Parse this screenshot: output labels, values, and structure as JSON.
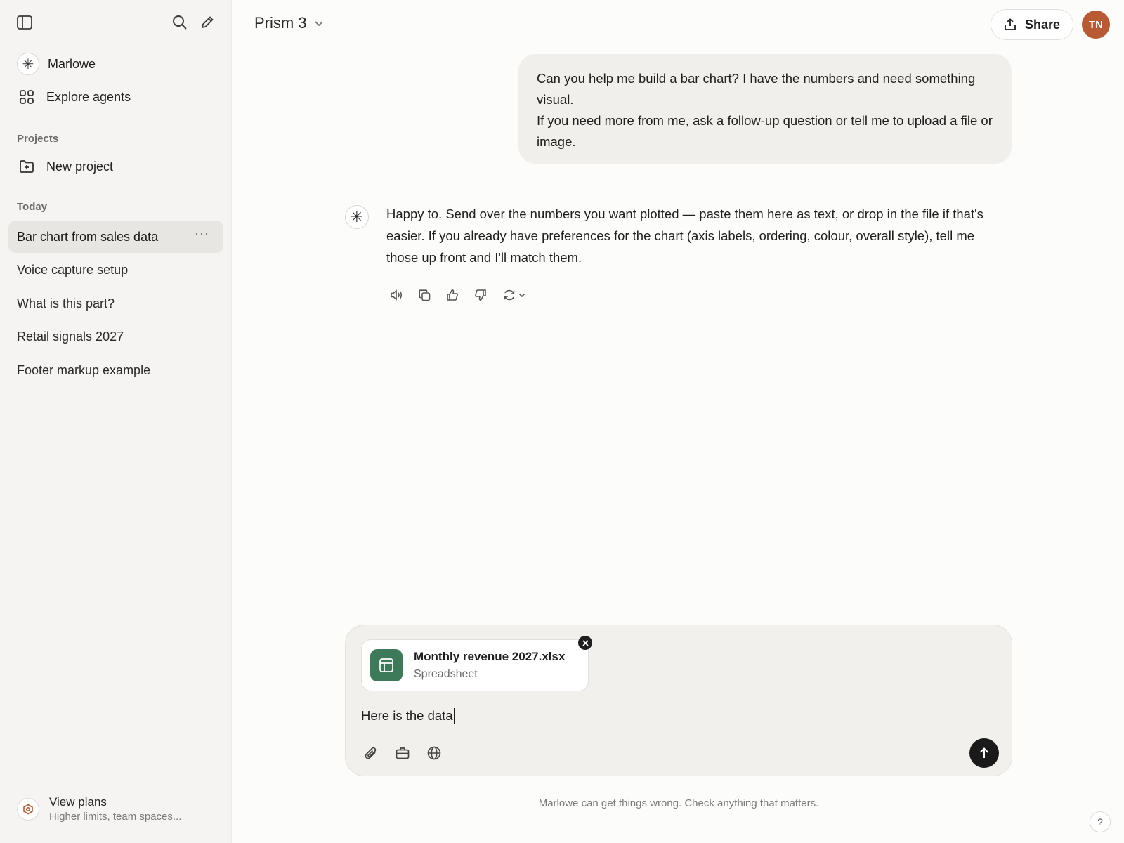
{
  "sidebar": {
    "toggle_icon": "sidebar-toggle-icon",
    "search_icon": "search-icon",
    "new_chat_icon": "pencil-icon",
    "brand": {
      "label": "Marlowe",
      "icon": "asterisk-icon"
    },
    "explore": {
      "label": "Explore agents",
      "icon": "grid-icon"
    },
    "projects_heading": "Projects",
    "new_project": {
      "label": "New project",
      "icon": "folder-plus-icon"
    },
    "today_heading": "Today",
    "chats": [
      {
        "label": "Bar chart from sales data",
        "active": true,
        "more": "···"
      },
      {
        "label": "Voice capture setup"
      },
      {
        "label": "What is this part?"
      },
      {
        "label": "Retail signals 2027"
      },
      {
        "label": "Footer markup example"
      }
    ],
    "plans": {
      "title": "View plans",
      "subtitle": "Higher limits, team spaces..."
    }
  },
  "header": {
    "model": "Prism 3",
    "share_label": "Share",
    "avatar_initials": "TN",
    "avatar_color": "#b85a33"
  },
  "conversation": {
    "user_message": {
      "line1": "Can you help me build a bar chart? I have the numbers and need something visual.",
      "line2": "If you need more from me, ask a follow-up question or tell me to upload a file or image."
    },
    "assistant_message": "Happy to. Send over the numbers you want plotted — paste them here as text, or drop in the file if that's easier. If you already have preferences for the chart (axis labels, ordering, colour, overall style), tell me those up front and I'll match them.",
    "actions": [
      "speaker-icon",
      "copy-icon",
      "thumbs-up-icon",
      "thumbs-down-icon",
      "regenerate-icon"
    ]
  },
  "composer": {
    "attachment": {
      "name": "Monthly revenue 2027.xlsx",
      "type": "Spreadsheet",
      "icon_color": "#3d7a5a"
    },
    "input_value": "Here is the data",
    "tools": [
      "paperclip-icon",
      "briefcase-icon",
      "globe-icon"
    ],
    "send_icon": "arrow-up-icon"
  },
  "disclaimer": "Marlowe can get things wrong. Check anything that matters.",
  "help_label": "?"
}
